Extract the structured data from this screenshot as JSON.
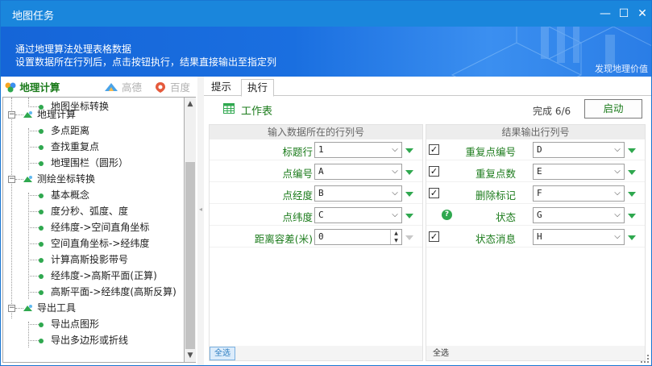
{
  "window": {
    "title": "地图任务",
    "controls": {
      "minimize": "—",
      "maximize": "☐",
      "close": "✕"
    }
  },
  "banner": {
    "line1": "通过地理算法处理表格数据",
    "line2": "设置数据所在行列后，点击按钮执行，结果直接输出至指定列",
    "found": "发现地理价值"
  },
  "left_tabs": [
    {
      "label": "地理计算",
      "active": true
    },
    {
      "label": "高德",
      "active": false
    },
    {
      "label": "百度",
      "active": false
    }
  ],
  "tree": {
    "top_item": "地图坐标转换",
    "groups": [
      {
        "label": "地理计算",
        "items": [
          "多点距离",
          "查找重复点",
          "地理围栏（圆形）"
        ]
      },
      {
        "label": "测绘坐标转换",
        "items": [
          "基本概念",
          "度分秒、弧度、度",
          "经纬度->空间直角坐标",
          "空间直角坐标->经纬度",
          "计算高斯投影带号",
          "经纬度->高斯平面(正算)",
          "高斯平面->经纬度(高斯反算)"
        ]
      },
      {
        "label": "导出工具",
        "items": [
          "导出点图形",
          "导出多边形或折线"
        ]
      }
    ]
  },
  "right_tabs": [
    {
      "label": "提示",
      "active": false
    },
    {
      "label": "执行",
      "active": true
    }
  ],
  "toolbar": {
    "sheet_label": "工作表",
    "progress": "完成 6/6",
    "start_label": "启动"
  },
  "input_section": {
    "header": "输入数据所在的行列号",
    "rows": [
      {
        "label": "标题行",
        "value": "1"
      },
      {
        "label": "点编号",
        "value": "A"
      },
      {
        "label": "点经度",
        "value": "B"
      },
      {
        "label": "点纬度",
        "value": "C"
      },
      {
        "label": "距离容差(米)",
        "value": "0"
      }
    ],
    "select_all": "全选"
  },
  "output_section": {
    "header": "结果输出行列号",
    "rows": [
      {
        "label": "重复点编号",
        "value": "D",
        "checked": true
      },
      {
        "label": "重复点数",
        "value": "E",
        "checked": true
      },
      {
        "label": "删除标记",
        "value": "F",
        "checked": true
      },
      {
        "label": "状态",
        "value": "G",
        "help": true
      },
      {
        "label": "状态消息",
        "value": "H",
        "checked": true
      }
    ],
    "select_all": "全选"
  },
  "colors": {
    "titlebar": "#1a86dc",
    "accent_green": "#1b7b1b",
    "bullet_green": "#2fa84f"
  }
}
